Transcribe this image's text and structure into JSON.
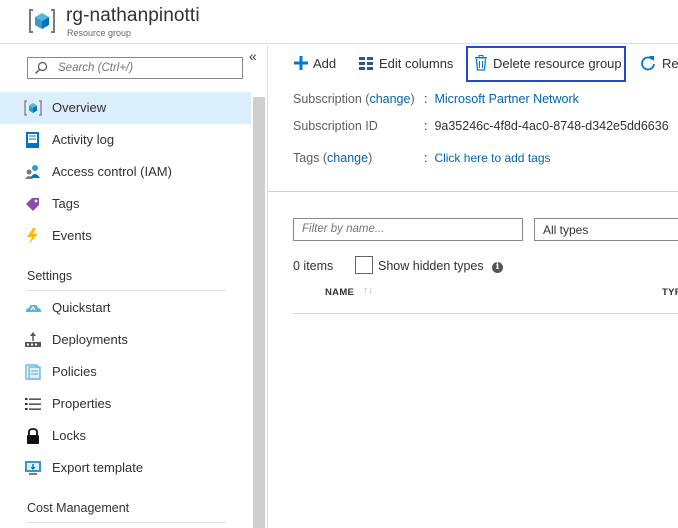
{
  "header": {
    "title": "rg-nathanpinotti",
    "subtitle": "Resource group"
  },
  "sidebar": {
    "search_placeholder": "Search (Ctrl+/)",
    "collapse_glyph": "«",
    "items": [
      {
        "label": "Overview",
        "icon": "resource-group-icon"
      },
      {
        "label": "Activity log",
        "icon": "activity-log-icon"
      },
      {
        "label": "Access control (IAM)",
        "icon": "people-icon"
      },
      {
        "label": "Tags",
        "icon": "tag-icon"
      },
      {
        "label": "Events",
        "icon": "lightning-icon"
      }
    ],
    "section_settings": "Settings",
    "settings_items": [
      {
        "label": "Quickstart",
        "icon": "cloud-icon"
      },
      {
        "label": "Deployments",
        "icon": "deployments-icon"
      },
      {
        "label": "Policies",
        "icon": "policies-icon"
      },
      {
        "label": "Properties",
        "icon": "list-icon"
      },
      {
        "label": "Locks",
        "icon": "lock-icon"
      },
      {
        "label": "Export template",
        "icon": "export-icon"
      }
    ],
    "section_cost": "Cost Management"
  },
  "toolbar": {
    "add": "Add",
    "edit_columns": "Edit columns",
    "delete_rg": "Delete resource group",
    "refresh": "Re"
  },
  "essentials": {
    "subscription_label": "Subscription",
    "subscription_change": "change",
    "subscription_value": "Microsoft Partner Network",
    "subscription_id_label": "Subscription ID",
    "subscription_id_value": "9a35246c-4f8d-4ac0-8748-d342e5dd6636",
    "tags_label": "Tags",
    "tags_change": "change",
    "tags_value": "Click here to add tags",
    "colon": ":"
  },
  "resources": {
    "filter_placeholder": "Filter by name...",
    "type_filter": "All types",
    "count": "0 items",
    "show_hidden": "Show hidden types",
    "info_glyph": "i",
    "col_name": "NAME",
    "sort_glyph": "↑↓",
    "col_type": "TYPE"
  },
  "colors": {
    "accent": "#0078d4",
    "active_bg": "#dbeefb",
    "focus_border": "#2446d4"
  }
}
